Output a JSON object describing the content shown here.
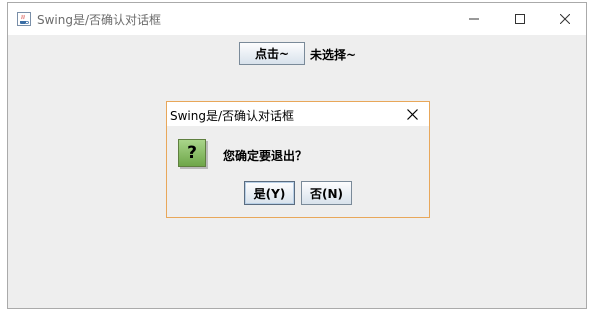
{
  "window": {
    "title": "Swing是/否确认对话框",
    "icon": "java-cup-icon",
    "controls": [
      "minimize-icon",
      "maximize-icon",
      "close-icon"
    ]
  },
  "main": {
    "click_button_label": "点击~",
    "status_label": "未选择~"
  },
  "dialog": {
    "title": "Swing是/否确认对话框",
    "icon": "question-icon",
    "icon_glyph": "?",
    "message": "您确定要退出？",
    "yes_label": "是(Y)",
    "no_label": "否(N)"
  },
  "colors": {
    "content_bg": "#eeeeee",
    "dialog_border": "#e8a75a",
    "button_border": "#7a8a99",
    "question_icon": "#6ea649"
  }
}
